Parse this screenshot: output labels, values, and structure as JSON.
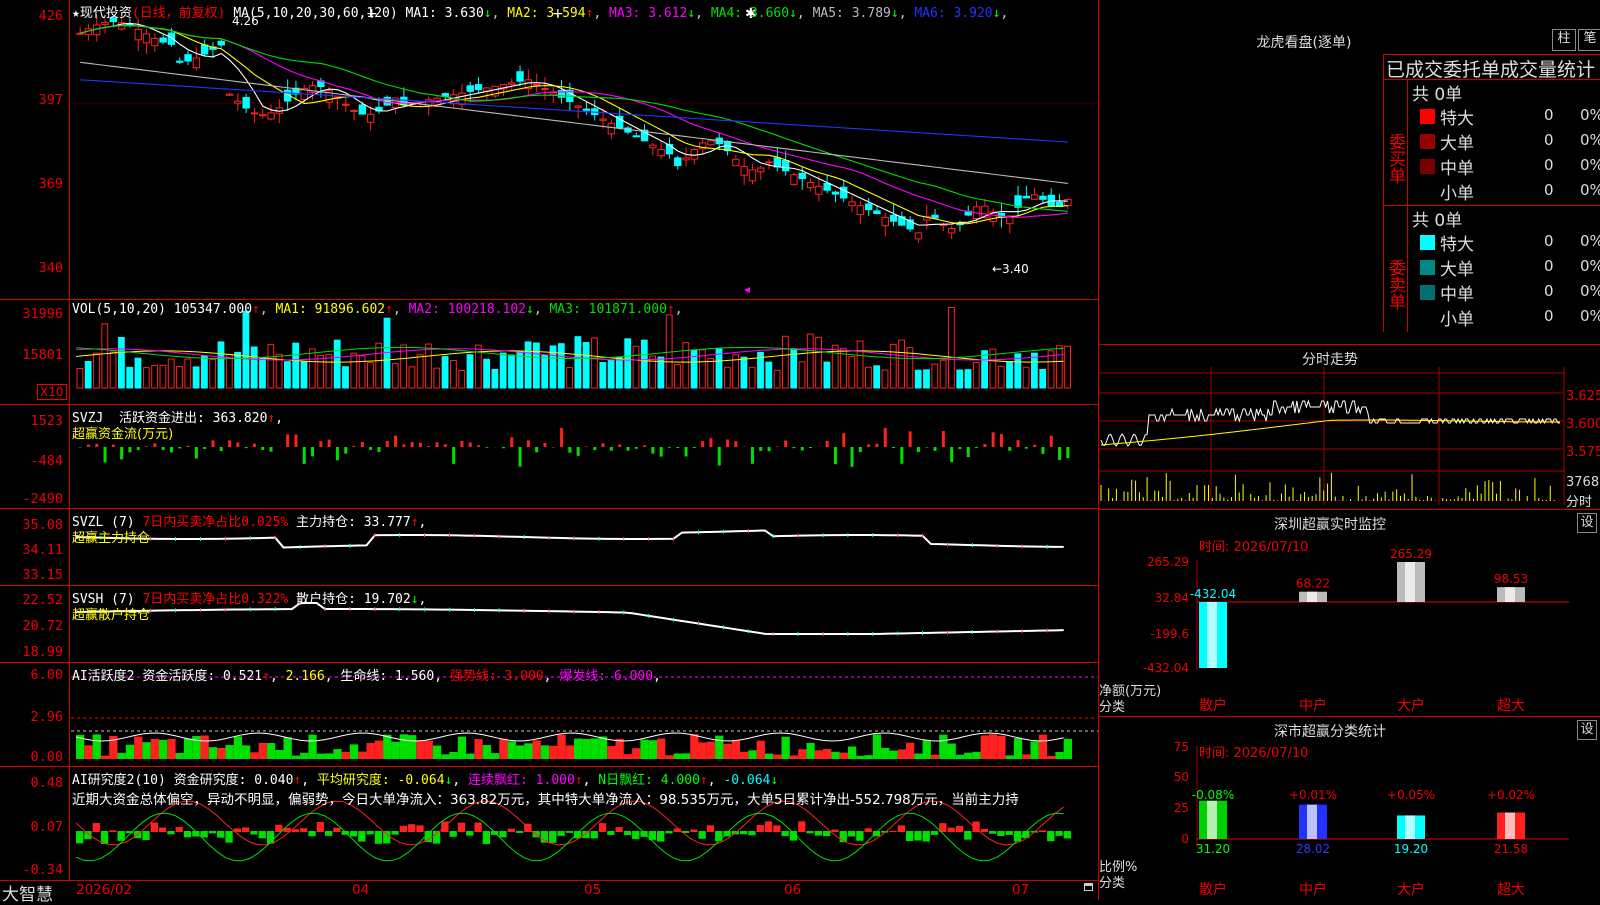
{
  "brand": "大智慧",
  "main_chart": {
    "title": "★现代投资",
    "period": "(日线，前复权)",
    "ma_label": "MA(5,10,20,30,60,120)",
    "ma": [
      {
        "name": "MA1:",
        "value": "3.630",
        "arrow": "↓",
        "color": "#ffffff"
      },
      {
        "name": "MA2:",
        "value": "3.594",
        "arrow": "↑",
        "color": "#ffff00"
      },
      {
        "name": "MA3:",
        "value": "3.612",
        "arrow": "↓",
        "color": "#ff00ff"
      },
      {
        "name": "MA4:",
        "value": "3.660",
        "arrow": "↓",
        "color": "#00e000"
      },
      {
        "name": "MA5:",
        "value": "3.789",
        "arrow": "↓",
        "color": "#bbbbbb"
      },
      {
        "name": "MA6:",
        "value": "3.920",
        "arrow": "↓",
        "color": "#2233ff"
      }
    ],
    "y_labels": [
      "426",
      "397",
      "369",
      "340"
    ],
    "high_mark": "4.26",
    "low_mark": "←3.40"
  },
  "vol": {
    "label": "VOL(5,10,20)",
    "value": "105347.000",
    "arrow": "↑",
    "ma": [
      {
        "name": "MA1:",
        "value": "91896.602",
        "arrow": "↑",
        "color": "#ffff00"
      },
      {
        "name": "MA2:",
        "value": "100218.102",
        "arrow": "↓",
        "color": "#ff00ff"
      },
      {
        "name": "MA3:",
        "value": "101871.000",
        "arrow": "↑",
        "color": "#00e000"
      }
    ],
    "y_labels": [
      "31996",
      "15801"
    ],
    "unit": "X10"
  },
  "svzj": {
    "label": "SVZJ",
    "name": "活跃资金进出:",
    "value": "363.820",
    "arrow": "↑",
    "subtitle": "超赢资金流(万元)",
    "y_labels": [
      "1523",
      "-484",
      "-2490"
    ]
  },
  "svzl": {
    "label": "SVZL (7)",
    "ratio_text": "7日内买卖净占比0.025%",
    "name": "主力持仓:",
    "value": "33.777",
    "arrow": "↑",
    "subtitle": "超赢主力持仓",
    "y_labels": [
      "35.08",
      "34.11",
      "33.15"
    ]
  },
  "svsh": {
    "label": "SVSH (7)",
    "ratio_text": "7日内买卖净占比0.322%",
    "name": "散户持仓:",
    "value": "19.702",
    "arrow": "↓",
    "subtitle": "超赢散户持仓",
    "y_labels": [
      "22.52",
      "20.72",
      "18.99"
    ]
  },
  "ai_active": {
    "label": "AI活跃度2",
    "name": "资金活跃度:",
    "value": "0.521",
    "arrow": "↑",
    "v2": "2.166",
    "life_name": "生命线:",
    "life": "1.560",
    "strong": "强势线: 3.000",
    "burst": "爆发线: 6.000",
    "y_labels": [
      "6.00",
      "2.96",
      "0.00"
    ]
  },
  "ai_research": {
    "label": "AI研究度2(10)",
    "name": "资金研究度:",
    "value": "0.040",
    "arrow": "↑",
    "avg": "平均研究度: -0.064",
    "avg_arrow": "↓",
    "cont": "连续飘红: 1.000",
    "cont_arrow": "↑",
    "nday": "N日飘红: 4.000",
    "nday_arrow": "↑",
    "last": "-0.064",
    "last_arrow": "↓",
    "comment": "近期大资金总体偏空，异动不明显，偏弱势，今日大单净流入：363.82万元，其中特大单净流入：98.535万元，大单5日累计净出-552.798万元，当前主力持",
    "y_labels": [
      "0.48",
      "0.07",
      "-0.34"
    ]
  },
  "x_axis": [
    "2026/02",
    "04",
    "05",
    "06",
    "07"
  ],
  "dragon": {
    "title": "龙虎看盘(逐单)",
    "btn1": "柱",
    "btn2": "笔",
    "header": "已成交委托单成交量统计",
    "buy": {
      "side_label": "委买单",
      "total": "共 0单",
      "rows": [
        {
          "name": "特大",
          "count": "0",
          "pct": "0%",
          "color": "#ff0000"
        },
        {
          "name": "大单",
          "count": "0",
          "pct": "0%",
          "color": "#990000"
        },
        {
          "name": "中单",
          "count": "0",
          "pct": "0%",
          "color": "#7a0000"
        },
        {
          "name": "小单",
          "count": "0",
          "pct": "0%",
          "color": ""
        }
      ]
    },
    "sell": {
      "side_label": "委卖单",
      "total": "共 0单",
      "rows": [
        {
          "name": "特大",
          "count": "0",
          "pct": "0%",
          "color": "#00ffff"
        },
        {
          "name": "大单",
          "count": "0",
          "pct": "0%",
          "color": "#008888"
        },
        {
          "name": "中单",
          "count": "0",
          "pct": "0%",
          "color": "#006f6f"
        },
        {
          "name": "小单",
          "count": "0",
          "pct": "0%",
          "color": ""
        }
      ]
    }
  },
  "intraday": {
    "title": "分时走势",
    "y_labels": [
      "3.625",
      "3.600",
      "3.575"
    ],
    "vol_label": "3768",
    "vol_unit": "分时"
  },
  "sz_monitor": {
    "title": "深圳超赢实时监控",
    "btn": "设",
    "time": "时间: 2026/07/10",
    "y_labels": [
      "265.29",
      "32.84",
      "-199.6",
      "-432.04"
    ],
    "unit_label": "净额(万元)",
    "cat_label": "分类",
    "categories": [
      "散户",
      "中户",
      "大户",
      "超大"
    ],
    "values": [
      -432.04,
      68.22,
      265.29,
      98.53
    ],
    "value_labels": [
      "-432.04",
      "68.22",
      "265.29",
      "98.53"
    ]
  },
  "sz_class": {
    "title": "深市超赢分类统计",
    "btn": "设",
    "time": "时间: 2026/07/10",
    "y_labels": [
      "75",
      "50",
      "25",
      "0"
    ],
    "unit_label": "比例%",
    "cat_label": "分类",
    "categories": [
      "散户",
      "中户",
      "大户",
      "超大"
    ],
    "values": [
      31.2,
      28.02,
      19.2,
      21.58
    ],
    "value_labels": [
      "31.20",
      "28.02",
      "19.20",
      "21.58"
    ],
    "changes": [
      "-0.08%",
      "+0.01%",
      "+0.05%",
      "+0.02%"
    ]
  }
}
